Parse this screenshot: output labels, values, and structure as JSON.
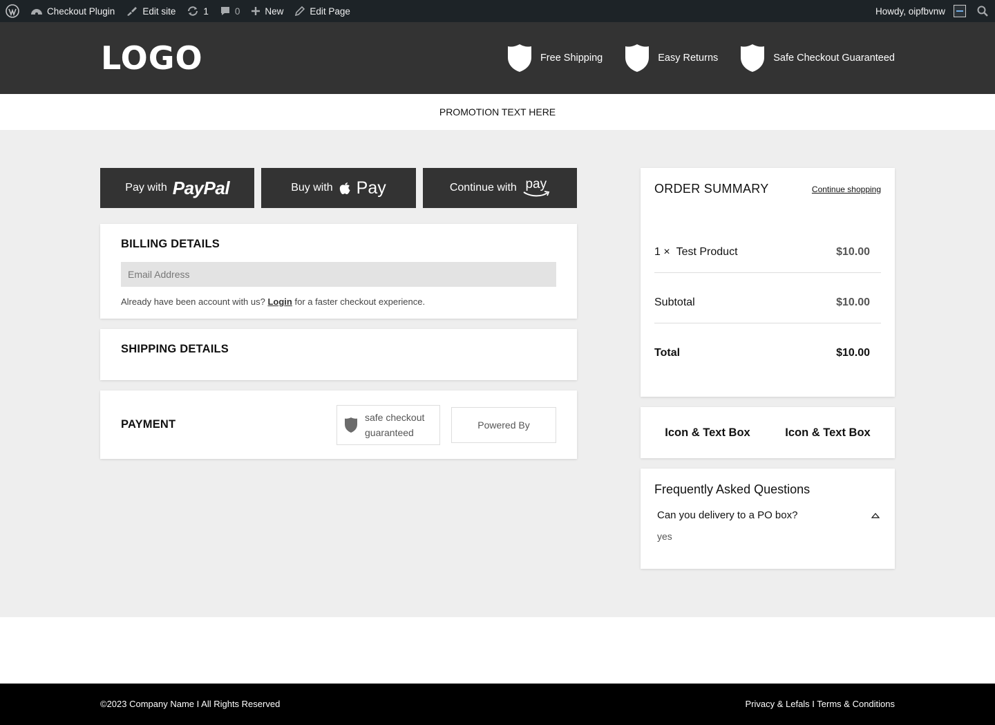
{
  "adminbar": {
    "site_name": "Checkout Plugin",
    "edit_site": "Edit site",
    "updates_count": "1",
    "comments_count": "0",
    "new_label": "New",
    "edit_page": "Edit Page",
    "howdy": "Howdy, oipfbvnw"
  },
  "header": {
    "logo": "LOGO",
    "features": [
      "Free Shipping",
      "Easy Returns",
      "Safe Checkout Guaranteed"
    ]
  },
  "promo": "PROMOTION TEXT HERE",
  "express": {
    "paypal_prefix": "Pay with",
    "paypal_brand": "PayPal",
    "apple_prefix": "Buy with",
    "apple_brand": "Pay",
    "amazon_prefix": "Continue with",
    "amazon_brand": "pay"
  },
  "billing": {
    "title": "BILLING DETAILS",
    "email_placeholder": "Email Address",
    "note_before": "Already have been account with us?",
    "login_link": "Login",
    "note_after": "for a faster checkout experience."
  },
  "shipping": {
    "title": "SHIPPING DETAILS"
  },
  "payment": {
    "title": "PAYMENT",
    "safe_line1": "safe checkout",
    "safe_line2": "guaranteed",
    "powered": "Powered By"
  },
  "summary": {
    "title": "ORDER SUMMARY",
    "continue": "Continue shopping",
    "item_qty": "1 ×",
    "item_name": "Test Product",
    "item_price": "$10.00",
    "subtotal_label": "Subtotal",
    "subtotal_value": "$10.00",
    "total_label": "Total",
    "total_value": "$10.00"
  },
  "iconbox": [
    "Icon & Text Box",
    "Icon & Text Box"
  ],
  "faq": {
    "title": "Frequently Asked Questions",
    "question": "Can you delivery to a PO box?",
    "answer": "yes"
  },
  "footer": {
    "copyright": "©2023 Company Name I All Rights Reserved",
    "links": "Privacy & Lefals I Terms & Conditions"
  },
  "colors": {
    "adminbar_bg": "#1d2327",
    "header_bg": "#333333",
    "page_bg": "#eeeeee",
    "footer_bg": "#000000"
  }
}
